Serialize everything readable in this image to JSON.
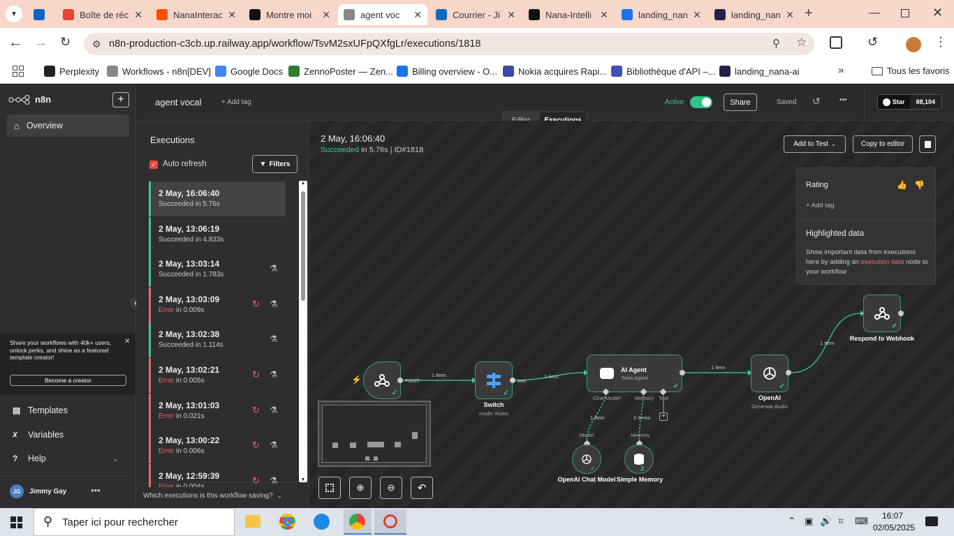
{
  "browser": {
    "tabs": [
      {
        "label": "",
        "icon": "linkedin-icon",
        "color": "#0a66c2"
      },
      {
        "label": "Boîte de réc",
        "icon": "gmail-icon",
        "color": "#ea4335"
      },
      {
        "label": "NanaInterac",
        "icon": "zapier-icon",
        "color": "#ff4f00"
      },
      {
        "label": "Montre moi",
        "icon": "openai-icon",
        "color": "#111111"
      },
      {
        "label": "agent voc",
        "icon": "n8n-icon",
        "color": "#888888"
      },
      {
        "label": "Courrier - Ji",
        "icon": "outlook-icon",
        "color": "#0f6cbd"
      },
      {
        "label": "Nana-Intelli",
        "icon": "openai-icon",
        "color": "#111111"
      },
      {
        "label": "landing_nan",
        "icon": "bolt-icon",
        "color": "#1a73e8"
      },
      {
        "label": "landing_nan",
        "icon": "openai-icon",
        "color": "#222244"
      }
    ],
    "url": "n8n-production-c3cb.up.railway.app/workflow/TsvM2sxUFpQXfgLr/executions/1818",
    "bookmarks": [
      {
        "label": "Perplexity",
        "color": "#222222"
      },
      {
        "label": "Workflows - n8n[DEV]",
        "color": "#888888"
      },
      {
        "label": "Google Docs",
        "color": "#4285f4"
      },
      {
        "label": "ZennoPoster — Zen...",
        "color": "#2e7d32"
      },
      {
        "label": "Billing overview - O...",
        "color": "#1a73e8"
      },
      {
        "label": "Nokia acquires Rapi...",
        "color": "#3949ab"
      },
      {
        "label": "Bibliothèque d'API –...",
        "color": "#3f51b5"
      },
      {
        "label": "landing_nana-ai",
        "color": "#222244"
      }
    ],
    "all_bookmarks": "Tous les favoris"
  },
  "sidebar": {
    "brand": "n8n",
    "overview": "Overview",
    "promo": {
      "text": "Share your workflows with 40k+ users, unlock perks, and shine as a featured template creator!",
      "button": "Become a creator"
    },
    "items": [
      {
        "label": "Templates",
        "icon": "templates-icon"
      },
      {
        "label": "Variables",
        "icon": "variables-icon"
      },
      {
        "label": "Help",
        "icon": "help-icon"
      }
    ],
    "user": {
      "initials": "JG",
      "name": "Jimmy Gay"
    }
  },
  "header": {
    "workflow_name": "agent vocal",
    "add_tag": "+ Add tag",
    "active_label": "Active",
    "share": "Share",
    "saved": "Saved",
    "star": "Star",
    "star_count": "88,104",
    "tabs": [
      "Editor",
      "Executions"
    ]
  },
  "executions": {
    "title": "Executions",
    "auto_refresh": "Auto refresh",
    "filters": "Filters",
    "rows": [
      {
        "date": "2 May, 16:06:40",
        "status": "Succeeded",
        "duration": "in 5.76s",
        "error": false,
        "retry": false,
        "test": false
      },
      {
        "date": "2 May, 13:06:19",
        "status": "Succeeded",
        "duration": "in 4.833s",
        "error": false,
        "retry": false,
        "test": false
      },
      {
        "date": "2 May, 13:03:14",
        "status": "Succeeded",
        "duration": "in 1.783s",
        "error": false,
        "retry": false,
        "test": true
      },
      {
        "date": "2 May, 13:03:09",
        "status": "Error",
        "duration": "in 0.009s",
        "error": true,
        "retry": true,
        "test": true
      },
      {
        "date": "2 May, 13:02:38",
        "status": "Succeeded",
        "duration": "in 1.114s",
        "error": false,
        "retry": false,
        "test": true
      },
      {
        "date": "2 May, 13:02:21",
        "status": "Error",
        "duration": "in 0.005s",
        "error": true,
        "retry": true,
        "test": true
      },
      {
        "date": "2 May, 13:01:03",
        "status": "Error",
        "duration": "in 0.021s",
        "error": true,
        "retry": true,
        "test": true
      },
      {
        "date": "2 May, 13:00:22",
        "status": "Error",
        "duration": "in 0.006s",
        "error": true,
        "retry": true,
        "test": true
      },
      {
        "date": "2 May, 12:59:39",
        "status": "Error",
        "duration": "in 0.004s",
        "error": true,
        "retry": true,
        "test": true
      }
    ],
    "footer": "Which executions is this workflow saving?"
  },
  "detail": {
    "date": "2 May, 16:06:40",
    "status": "Succeeded",
    "duration": " in 5.76s | ID#1818",
    "add_to_test": "Add to Test",
    "copy_to_editor": "Copy to editor"
  },
  "info_panel": {
    "rating": "Rating",
    "add_tag": "+ Add tag",
    "highlighted_title": "Highlighted data",
    "highlighted_text_1": "Show important data from executions here by adding an ",
    "highlighted_link": "execution data",
    "highlighted_text_2": " node to your workflow"
  },
  "workflow": {
    "webhook_out": "POST",
    "edge1": "1 item",
    "switch": {
      "name": "Switch",
      "sub": "mode: Rules"
    },
    "switch_out": "text",
    "edge2": "1 item",
    "agent": {
      "name": "AI Agent",
      "sub": "Tools Agent"
    },
    "agent_ports": {
      "chat": "Chat Model",
      "chat_req": "*",
      "memory": "Memory",
      "tool": "Tool"
    },
    "edge3": "1 item",
    "openai": {
      "name": "OpenAI",
      "sub": "Generate Audio"
    },
    "edge4": "1 item",
    "respond": {
      "name": "Respond to Webhook"
    },
    "chat_edge": "1 item",
    "chat_port": "Model",
    "memory_edge": "2 items",
    "memory_port": "Memory",
    "chat_model": {
      "name": "OpenAI Chat Model"
    },
    "memory_node": {
      "name": "Simple Memory",
      "badge": "2"
    }
  },
  "taskbar": {
    "search_placeholder": "Taper ici pour rechercher",
    "time": "16:07",
    "date": "02/05/2025"
  }
}
